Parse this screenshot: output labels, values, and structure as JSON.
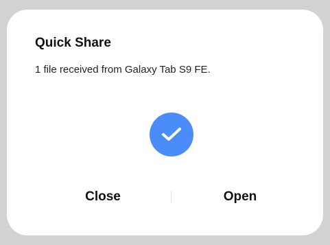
{
  "dialog": {
    "title": "Quick Share",
    "message": "1 file received from Galaxy Tab S9 FE.",
    "status_icon": "checkmark-circle-icon",
    "accent_color": "#4b8df8",
    "buttons": {
      "close_label": "Close",
      "open_label": "Open"
    }
  }
}
